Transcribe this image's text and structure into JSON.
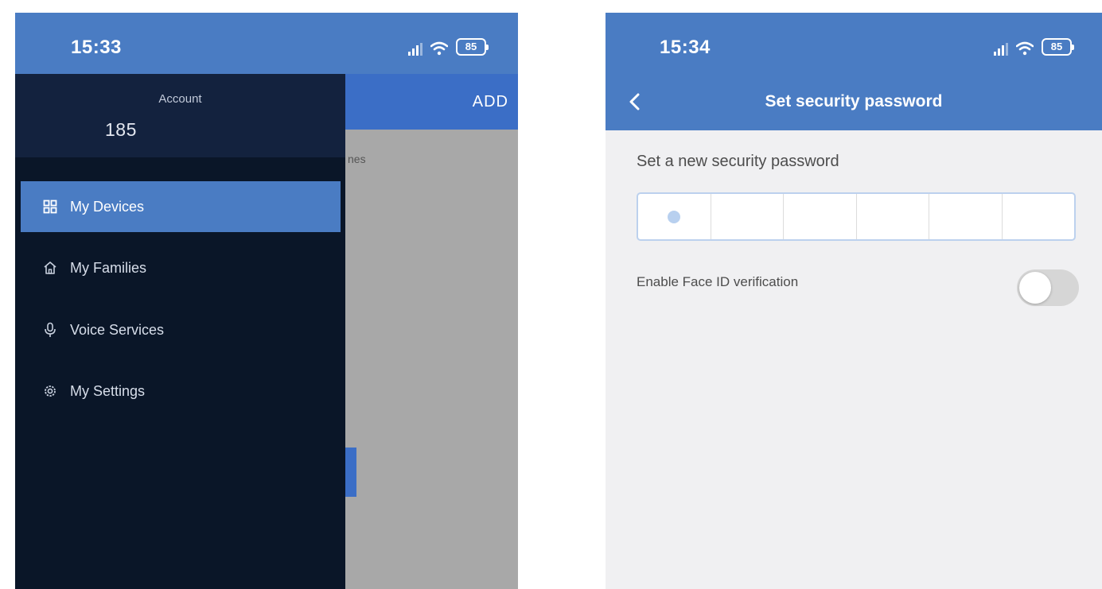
{
  "left_screen": {
    "status": {
      "time": "15:33",
      "battery": "85"
    },
    "background_app": {
      "action_label": "ADD",
      "peek_text": "nes"
    },
    "drawer": {
      "account_label": "Account",
      "account_value": "185",
      "items": [
        {
          "label": "My Devices",
          "icon": "grid-icon",
          "active": true
        },
        {
          "label": "My Families",
          "icon": "home-icon",
          "active": false
        },
        {
          "label": "Voice Services",
          "icon": "microphone-icon",
          "active": false
        },
        {
          "label": "My Settings",
          "icon": "gear-icon",
          "active": false
        }
      ]
    }
  },
  "right_screen": {
    "status": {
      "time": "15:34",
      "battery": "85"
    },
    "nav": {
      "title": "Set security password",
      "back_icon": "chevron-left-icon"
    },
    "password": {
      "label": "Set a new security password",
      "length": 6,
      "entered": 1
    },
    "face_id": {
      "label": "Enable Face ID verification",
      "enabled": false
    }
  },
  "colors": {
    "header_blue": "#4a7cc3",
    "drawer_bg": "#0a1628",
    "overlay_gray": "#a8a8a8",
    "page_bg": "#f0f0f2"
  }
}
